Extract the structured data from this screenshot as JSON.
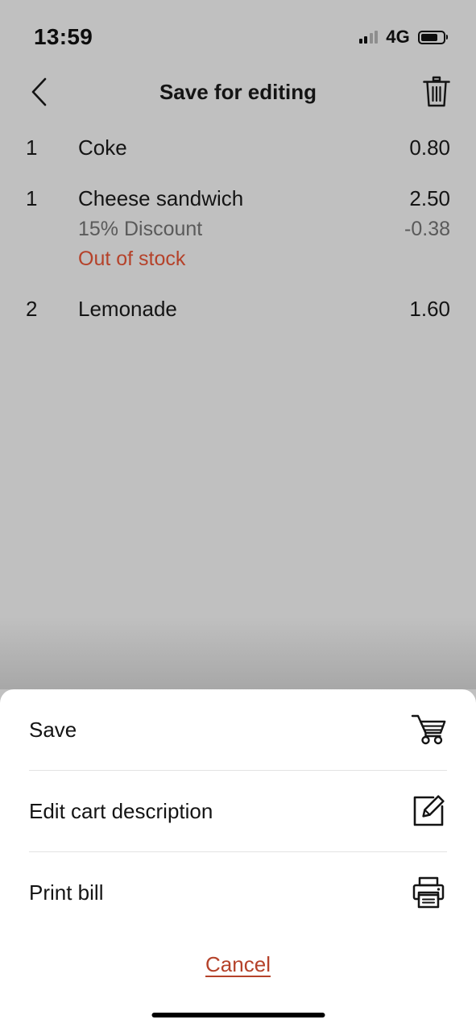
{
  "status_bar": {
    "time": "13:59",
    "network_type": "4G",
    "signal_icon": "signal-bars-icon",
    "battery_icon": "battery-icon",
    "battery_level": 75
  },
  "nav_bar": {
    "title": "Save for editing",
    "back_icon": "chevron-left-icon",
    "delete_icon": "trash-icon"
  },
  "cart": {
    "items": [
      {
        "qty": "1",
        "name": "Coke",
        "price": "0.80"
      },
      {
        "qty": "1",
        "name": "Cheese sandwich",
        "price": "2.50",
        "discount_label": "15% Discount",
        "discount_amount": "-0.38",
        "status": "Out of stock"
      },
      {
        "qty": "2",
        "name": "Lemonade",
        "price": "1.60"
      }
    ]
  },
  "action_sheet": {
    "rows": [
      {
        "label": "Save",
        "icon": "shopping-cart-icon"
      },
      {
        "label": "Edit cart description",
        "icon": "edit-pencil-icon"
      },
      {
        "label": "Print bill",
        "icon": "printer-icon"
      }
    ],
    "cancel_label": "Cancel"
  },
  "colors": {
    "background": "#c0c0c0",
    "sheet": "#ffffff",
    "text": "#141414",
    "muted": "#5a5a5a",
    "accent": "#b5422a",
    "divider": "#e3e3e3"
  }
}
